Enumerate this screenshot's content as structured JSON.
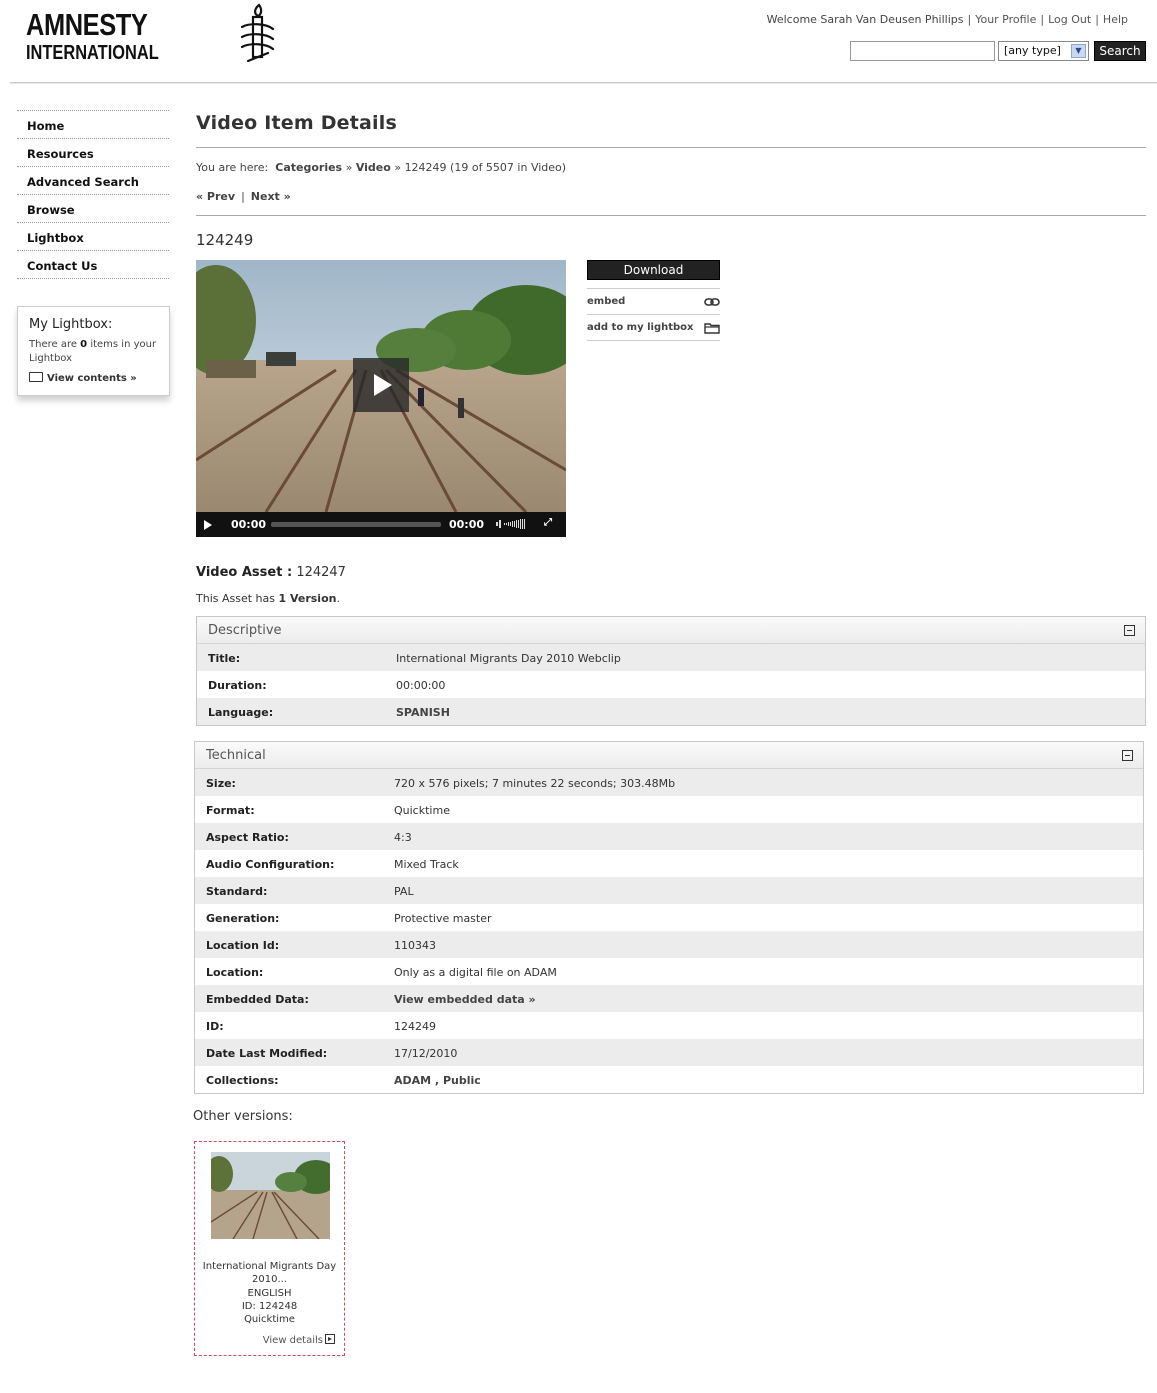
{
  "brand": {
    "line1": "AMNESTY",
    "line2": "INTERNATIONAL"
  },
  "topnav": {
    "welcome": "Welcome Sarah Van Deusen Phillips",
    "profile": "Your Profile",
    "logout": "Log Out",
    "help": "Help"
  },
  "search": {
    "input_value": "",
    "type_selected": "[any type]",
    "button_label": "Search"
  },
  "sidebar": {
    "items": [
      {
        "label": "Home"
      },
      {
        "label": "Resources"
      },
      {
        "label": "Advanced Search"
      },
      {
        "label": "Browse"
      },
      {
        "label": "Lightbox"
      },
      {
        "label": "Contact Us"
      }
    ],
    "lightbox": {
      "title": "My Lightbox:",
      "text_before": "There are ",
      "count": "0",
      "text_after": " items in your Lightbox",
      "view": "View contents »"
    }
  },
  "page": {
    "title": "Video Item Details",
    "breadcrumb": {
      "prefix": "You are here:",
      "categories": "Categories",
      "sep1": "»",
      "video": "Video",
      "sep2": "»",
      "current": "124249 (19 of 5507 in Video)"
    },
    "prev": "« Prev",
    "pipe": "|",
    "next": "Next »",
    "asset_id": "124249"
  },
  "player": {
    "time_current": "00:00",
    "time_total": "00:00"
  },
  "actions": {
    "download": "Download",
    "embed": "embed",
    "add_lightbox": "add to my lightbox"
  },
  "video_asset": {
    "label": "Video Asset :",
    "id": "124247",
    "versions_text": "This Asset has ",
    "versions_count": "1 Version",
    "versions_end": "."
  },
  "descriptive": {
    "title": "Descriptive",
    "rows": [
      {
        "k": "Title:",
        "v": "International Migrants Day 2010 Webclip"
      },
      {
        "k": "Duration:",
        "v": "00:00:00"
      },
      {
        "k": "Language:",
        "v": "SPANISH"
      }
    ]
  },
  "technical": {
    "title": "Technical",
    "rows": [
      {
        "k": "Size:",
        "v": "720 x 576 pixels; 7 minutes 22 seconds; 303.48Mb"
      },
      {
        "k": "Format:",
        "v": "Quicktime"
      },
      {
        "k": "Aspect Ratio:",
        "v": "4:3"
      },
      {
        "k": "Audio Configuration:",
        "v": "Mixed Track"
      },
      {
        "k": "Standard:",
        "v": "PAL"
      },
      {
        "k": "Generation:",
        "v": "Protective master"
      },
      {
        "k": "Location Id:",
        "v": "110343"
      },
      {
        "k": "Location:",
        "v": "Only as a digital file on ADAM"
      },
      {
        "k": "Embedded Data:",
        "v": "View embedded data »"
      },
      {
        "k": "ID:",
        "v": "124249"
      },
      {
        "k": "Date Last Modified:",
        "v": "17/12/2010"
      },
      {
        "k": "Collections:",
        "v": "ADAM , Public"
      }
    ]
  },
  "other_versions": {
    "title": "Other versions:",
    "card": {
      "line1": "International Migrants Day",
      "line2": "2010...",
      "line3": "ENGLISH",
      "line4": "ID: 124248",
      "line5": "Quicktime",
      "view": "View details"
    }
  }
}
